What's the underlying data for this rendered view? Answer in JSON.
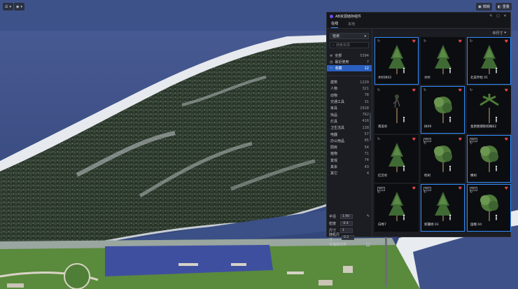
{
  "viewport": {
    "top_left_chips": [
      {
        "icon": "layers-icon",
        "label": ""
      },
      {
        "icon": "camera-icon",
        "label": ""
      }
    ],
    "top_right_chips": [
      {
        "icon": "view-icon",
        "label": "模糊"
      },
      {
        "icon": "cam-icon",
        "label": "重叠"
      }
    ]
  },
  "panel": {
    "title": "AB资源储存组件",
    "tabs": [
      "在线",
      "本地"
    ],
    "active_tab": 0,
    "sort_label": "中尺寸",
    "filter_select": "植被",
    "search_placeholder": "搜索资源",
    "quick_items": [
      {
        "icon": "list-icon",
        "label": "全部",
        "count": "5394"
      },
      {
        "icon": "clock-icon",
        "label": "最近使用",
        "count": "7"
      },
      {
        "icon": "heart-outline-icon",
        "label": "收藏",
        "count": "12"
      }
    ],
    "categories": [
      {
        "label": "建筑",
        "count": "1229"
      },
      {
        "label": "人物",
        "count": "321"
      },
      {
        "label": "动物",
        "count": "78"
      },
      {
        "label": "交通工具",
        "count": "31"
      },
      {
        "label": "家具",
        "count": "2918"
      },
      {
        "label": "饰品",
        "count": "762"
      },
      {
        "label": "灯具",
        "count": "416"
      },
      {
        "label": "卫生洁具",
        "count": "138"
      },
      {
        "label": "电器",
        "count": "57"
      },
      {
        "label": "办公用品",
        "count": "65"
      },
      {
        "label": "厨房",
        "count": "54"
      },
      {
        "label": "植物",
        "count": "71"
      },
      {
        "label": "景观",
        "count": "74"
      },
      {
        "label": "其余",
        "count": "43"
      },
      {
        "label": "其它",
        "count": "4"
      }
    ],
    "params": [
      {
        "label": "半径",
        "value": "1.90"
      },
      {
        "label": "密度",
        "value": "-0.4"
      },
      {
        "label": "尺寸",
        "value": "1"
      },
      {
        "label": "随机尺寸",
        "value": "0.2"
      }
    ],
    "align_label": "与地形对齐",
    "assets": [
      {
        "label": "水杉树02",
        "selected": true,
        "pro": false
      },
      {
        "label": "水杉",
        "selected": false,
        "pro": false
      },
      {
        "label": "北美乔松 01",
        "selected": true,
        "pro": false
      },
      {
        "label": "南美杉",
        "selected": false,
        "pro": false
      },
      {
        "label": "树09",
        "selected": true,
        "pro": false
      },
      {
        "label": "金斯图德斯棕榈02",
        "selected": false,
        "pro": false
      },
      {
        "label": "红云杉",
        "selected": false,
        "pro": false
      },
      {
        "label": "栎树",
        "selected": false,
        "pro": true
      },
      {
        "label": "橡树",
        "selected": true,
        "pro": true
      },
      {
        "label": "白桦7",
        "selected": false,
        "pro": true
      },
      {
        "label": "新疆杨 03",
        "selected": true,
        "pro": true
      },
      {
        "label": "国槐 04",
        "selected": true,
        "pro": true
      }
    ]
  }
}
